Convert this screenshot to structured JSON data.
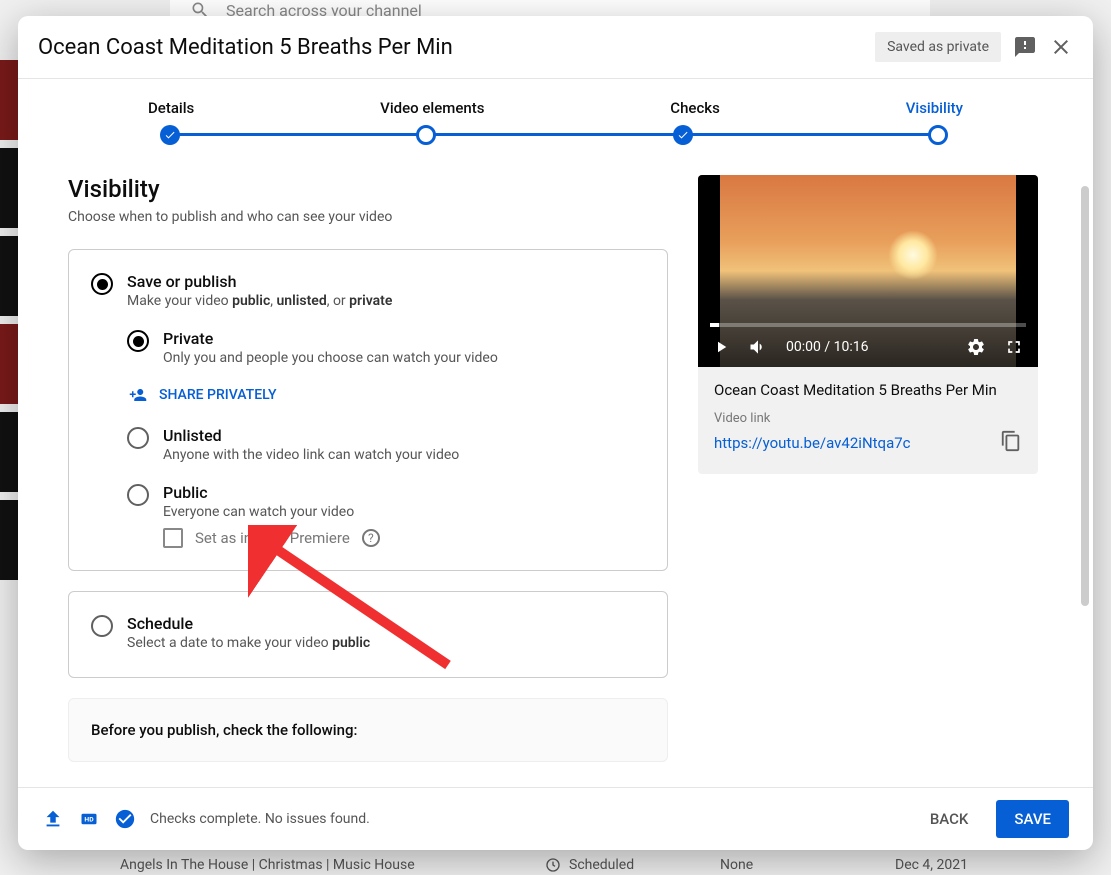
{
  "bg": {
    "search_placeholder": "Search across your channel",
    "row_title": "Angels In The House | Christmas | Music House",
    "row_status": "Scheduled",
    "row_restrict": "None",
    "row_date": "Dec 4, 2021"
  },
  "header": {
    "title": "Ocean Coast Meditation 5 Breaths Per Min",
    "saved_badge": "Saved as private"
  },
  "stepper": {
    "s1": "Details",
    "s2": "Video elements",
    "s3": "Checks",
    "s4": "Visibility"
  },
  "visibility": {
    "heading": "Visibility",
    "subheading": "Choose when to publish and who can see your video",
    "save_publish": {
      "title": "Save or publish",
      "desc_pre": "Make your video ",
      "desc_public": "public",
      "desc_sep1": ", ",
      "desc_unlisted": "unlisted",
      "desc_sep2": ", or ",
      "desc_private": "private"
    },
    "private": {
      "title": "Private",
      "desc": "Only you and people you choose can watch your video"
    },
    "share_privately": "SHARE PRIVATELY",
    "unlisted": {
      "title": "Unlisted",
      "desc": "Anyone with the video link can watch your video"
    },
    "public": {
      "title": "Public",
      "desc": "Everyone can watch your video"
    },
    "premiere": "Set as instant Premiere",
    "schedule": {
      "title": "Schedule",
      "desc_pre": "Select a date to make your video ",
      "desc_public": "public"
    },
    "before_publish": "Before you publish, check the following:"
  },
  "video": {
    "time": "00:00 / 10:16",
    "title": "Ocean Coast Meditation 5 Breaths Per Min",
    "link_label": "Video link",
    "link": "https://youtu.be/av42iNtqa7c"
  },
  "footer": {
    "status": "Checks complete. No issues found.",
    "back": "BACK",
    "save": "SAVE"
  }
}
